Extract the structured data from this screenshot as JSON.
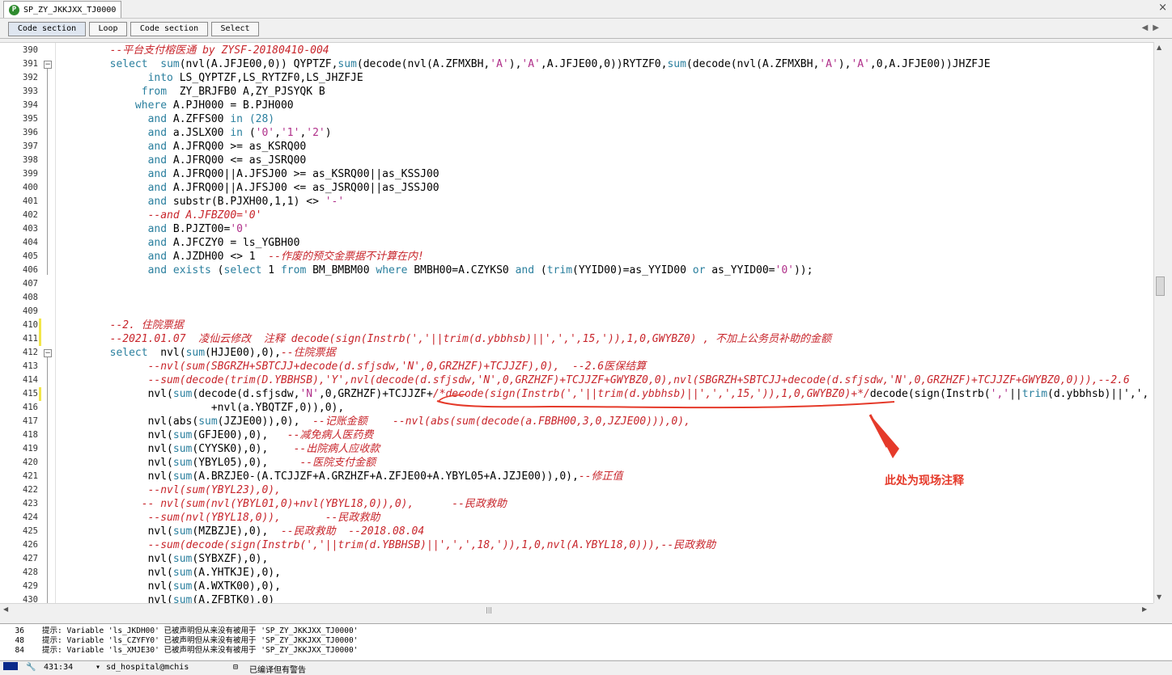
{
  "tab": {
    "title": "SP_ZY_JKKJXX_TJ0000",
    "icon": "procedure-icon",
    "close": "×"
  },
  "toolbar": {
    "buttons": [
      "Code section",
      "Loop",
      "Code section",
      "Select"
    ],
    "nav": "◀▶"
  },
  "editor": {
    "lines": [
      {
        "n": "390",
        "segs": [
          [
            "cm",
            "        --平台支付榕医通 by ZYSF-20180410-004"
          ]
        ]
      },
      {
        "n": "391",
        "segs": [
          [
            "",
            "        "
          ],
          [
            "kw",
            "select"
          ],
          [
            "",
            "  "
          ],
          [
            "kw",
            "sum"
          ],
          [
            "",
            "(nvl(A.JFJE00,0)) QYPTZF,"
          ],
          [
            "kw",
            "sum"
          ],
          [
            "",
            "(decode(nvl(A.ZFMXBH,"
          ],
          [
            "st",
            "'A'"
          ],
          [
            "",
            "),"
          ],
          [
            "st",
            "'A'"
          ],
          [
            "",
            ",A.JFJE00,0))RYTZF0,"
          ],
          [
            "kw",
            "sum"
          ],
          [
            "",
            "(decode(nvl(A.ZFMXBH,"
          ],
          [
            "st",
            "'A'"
          ],
          [
            "",
            "),"
          ],
          [
            "st",
            "'A'"
          ],
          [
            "",
            ",0,A.JFJE00))JHZFJE"
          ]
        ]
      },
      {
        "n": "392",
        "segs": [
          [
            "",
            "              "
          ],
          [
            "kw",
            "into"
          ],
          [
            "",
            " LS_QYPTZF,LS_RYTZF0,LS_JHZFJE"
          ]
        ]
      },
      {
        "n": "393",
        "segs": [
          [
            "",
            "             "
          ],
          [
            "kw",
            "from"
          ],
          [
            "",
            "  ZY_BRJFB0 A,ZY_PJSYQK B"
          ]
        ]
      },
      {
        "n": "394",
        "segs": [
          [
            "",
            "            "
          ],
          [
            "kw",
            "where"
          ],
          [
            "",
            " A.PJH000 = B.PJH000"
          ]
        ]
      },
      {
        "n": "395",
        "segs": [
          [
            "",
            "              "
          ],
          [
            "kw",
            "and"
          ],
          [
            "",
            " A.ZFFS00 "
          ],
          [
            "kw",
            "in"
          ],
          [
            "",
            " "
          ],
          [
            "kw",
            "(28)"
          ]
        ]
      },
      {
        "n": "396",
        "segs": [
          [
            "",
            "              "
          ],
          [
            "kw",
            "and"
          ],
          [
            "",
            " a.JSLX00 "
          ],
          [
            "kw",
            "in"
          ],
          [
            "",
            " ("
          ],
          [
            "st",
            "'0'"
          ],
          [
            "",
            ","
          ],
          [
            "st",
            "'1'"
          ],
          [
            "",
            ","
          ],
          [
            "st",
            "'2'"
          ],
          [
            "",
            ")"
          ]
        ]
      },
      {
        "n": "397",
        "segs": [
          [
            "",
            "              "
          ],
          [
            "kw",
            "and"
          ],
          [
            "",
            " A.JFRQ00 >= as_KSRQ00"
          ]
        ]
      },
      {
        "n": "398",
        "segs": [
          [
            "",
            "              "
          ],
          [
            "kw",
            "and"
          ],
          [
            "",
            " A.JFRQ00 <= as_JSRQ00"
          ]
        ]
      },
      {
        "n": "399",
        "segs": [
          [
            "",
            "              "
          ],
          [
            "kw",
            "and"
          ],
          [
            "",
            " A.JFRQ00||A.JFSJ00 >= as_KSRQ00||as_KSSJ00"
          ]
        ]
      },
      {
        "n": "400",
        "segs": [
          [
            "",
            "              "
          ],
          [
            "kw",
            "and"
          ],
          [
            "",
            " A.JFRQ00||A.JFSJ00 <= as_JSRQ00||as_JSSJ00"
          ]
        ]
      },
      {
        "n": "401",
        "segs": [
          [
            "",
            "              "
          ],
          [
            "kw",
            "and"
          ],
          [
            "",
            " substr(B.PJXH00,1,1) <> "
          ],
          [
            "st",
            "'-'"
          ]
        ]
      },
      {
        "n": "402",
        "segs": [
          [
            "cm",
            "              --and A.JFBZ00='0'"
          ]
        ]
      },
      {
        "n": "403",
        "segs": [
          [
            "",
            "              "
          ],
          [
            "kw",
            "and"
          ],
          [
            "",
            " B.PJZT00="
          ],
          [
            "st",
            "'0'"
          ]
        ]
      },
      {
        "n": "404",
        "segs": [
          [
            "",
            "              "
          ],
          [
            "kw",
            "and"
          ],
          [
            "",
            " A.JFCZY0 = ls_YGBH00"
          ]
        ]
      },
      {
        "n": "405",
        "segs": [
          [
            "",
            "              "
          ],
          [
            "kw",
            "and"
          ],
          [
            "",
            " A.JZDH00 <> 1  "
          ],
          [
            "cm",
            "--作废的预交金票据不计算在内!"
          ]
        ]
      },
      {
        "n": "406",
        "segs": [
          [
            "",
            "              "
          ],
          [
            "kw",
            "and exists"
          ],
          [
            "",
            " ("
          ],
          [
            "kw",
            "select"
          ],
          [
            "",
            " 1 "
          ],
          [
            "kw",
            "from"
          ],
          [
            "",
            " BM_BMBM00 "
          ],
          [
            "kw",
            "where"
          ],
          [
            "",
            " BMBH00=A.CZYKS0 "
          ],
          [
            "kw",
            "and"
          ],
          [
            "",
            " ("
          ],
          [
            "kw",
            "trim"
          ],
          [
            "",
            "(YYID00)=as_YYID00 "
          ],
          [
            "kw",
            "or"
          ],
          [
            "",
            " as_YYID00="
          ],
          [
            "st",
            "'0'"
          ],
          [
            "",
            "));"
          ]
        ]
      },
      {
        "n": "407",
        "segs": [
          [
            "",
            ""
          ]
        ]
      },
      {
        "n": "408",
        "segs": [
          [
            "",
            ""
          ]
        ]
      },
      {
        "n": "409",
        "segs": [
          [
            "",
            ""
          ]
        ]
      },
      {
        "n": "410",
        "segs": [
          [
            "cm",
            "        --2. 住院票据"
          ]
        ]
      },
      {
        "n": "411",
        "segs": [
          [
            "cm",
            "        --2021.01.07  凌仙云修改  注释 decode(sign(Instrb(','||trim(d.ybbhsb)||',',',15,')),1,0,GWYBZ0) , 不加上公务员补助的金额"
          ]
        ]
      },
      {
        "n": "412",
        "segs": [
          [
            "",
            "        "
          ],
          [
            "kw",
            "select"
          ],
          [
            "",
            "  nvl("
          ],
          [
            "kw",
            "sum"
          ],
          [
            "",
            "(HJJE00),0),"
          ],
          [
            "cm",
            "--住院票据"
          ]
        ]
      },
      {
        "n": "413",
        "segs": [
          [
            "cm",
            "              --nvl(sum(SBGRZH+SBTCJJ+decode(d.sfjsdw,'N',0,GRZHZF)+TCJJZF),0),  --2.6医保结算"
          ]
        ]
      },
      {
        "n": "414",
        "segs": [
          [
            "cm",
            "              --sum(decode(trim(D.YBBHSB),'Y',nvl(decode(d.sfjsdw,'N',0,GRZHZF)+TCJJZF+GWYBZ0,0),nvl(SBGRZH+SBTCJJ+decode(d.sfjsdw,'N',0,GRZHZF)+TCJJZF+GWYBZ0,0))),--2.6"
          ]
        ]
      },
      {
        "n": "415",
        "segs": [
          [
            "",
            "              nvl("
          ],
          [
            "kw",
            "sum"
          ],
          [
            "",
            "(decode(d.sfjsdw,"
          ],
          [
            "st",
            "'N'"
          ],
          [
            "",
            ",0,GRZHZF)+TCJJZF+"
          ],
          [
            "cm",
            "/*decode(sign(Instrb(','||trim(d.ybbhsb)||',',',15,')),1,0,GWYBZ0)+*/"
          ],
          [
            "",
            "decode(sign(Instrb("
          ],
          [
            "st",
            "','"
          ],
          [
            "",
            "||"
          ],
          [
            "kw",
            "trim"
          ],
          [
            "",
            "(d.ybbhsb)||',',"
          ]
        ]
      },
      {
        "n": "416",
        "segs": [
          [
            "",
            "                        +nvl(a.YBQTZF,0)),0),"
          ]
        ]
      },
      {
        "n": "417",
        "segs": [
          [
            "",
            "              nvl(abs("
          ],
          [
            "kw",
            "sum"
          ],
          [
            "",
            "(JZJE00)),0),  "
          ],
          [
            "cm",
            "--记账金额    --nvl(abs(sum(decode(a.FBBH00,3,0,JZJE00))),0),"
          ]
        ]
      },
      {
        "n": "418",
        "segs": [
          [
            "",
            "              nvl("
          ],
          [
            "kw",
            "sum"
          ],
          [
            "",
            "(GFJE00),0),   "
          ],
          [
            "cm",
            "--减免病人医药费"
          ]
        ]
      },
      {
        "n": "419",
        "segs": [
          [
            "",
            "              nvl("
          ],
          [
            "kw",
            "sum"
          ],
          [
            "",
            "(CYYSK0),0),    "
          ],
          [
            "cm",
            "--出院病人应收款"
          ]
        ]
      },
      {
        "n": "420",
        "segs": [
          [
            "",
            "              nvl("
          ],
          [
            "kw",
            "sum"
          ],
          [
            "",
            "(YBYL05),0),     "
          ],
          [
            "cm",
            "--医院支付金额"
          ]
        ]
      },
      {
        "n": "421",
        "segs": [
          [
            "",
            "              nvl("
          ],
          [
            "kw",
            "sum"
          ],
          [
            "",
            "(A.BRZJE0-(A.TCJJZF+A.GRZHZF+A.ZFJE00+A.YBYL05+A.JZJE00)),0),"
          ],
          [
            "cm",
            "--修正值"
          ]
        ]
      },
      {
        "n": "422",
        "segs": [
          [
            "cm",
            "              --nvl(sum(YBYL23),0),"
          ]
        ]
      },
      {
        "n": "423",
        "segs": [
          [
            "cm",
            "             -- nvl(sum(nvl(YBYL01,0)+nvl(YBYL18,0)),0),      --民政救助"
          ]
        ]
      },
      {
        "n": "424",
        "segs": [
          [
            "cm",
            "              --sum(nvl(YBYL18,0)),       --民政救助"
          ]
        ]
      },
      {
        "n": "425",
        "segs": [
          [
            "",
            "              nvl("
          ],
          [
            "kw",
            "sum"
          ],
          [
            "",
            "(MZBZJE),0),  "
          ],
          [
            "cm",
            "--民政救助  --2018.08.04"
          ]
        ]
      },
      {
        "n": "426",
        "segs": [
          [
            "cm",
            "              --sum(decode(sign(Instrb(','||trim(d.YBBHSB)||',',',18,')),1,0,nvl(A.YBYL18,0))),--民政救助"
          ]
        ]
      },
      {
        "n": "427",
        "segs": [
          [
            "",
            "              nvl("
          ],
          [
            "kw",
            "sum"
          ],
          [
            "",
            "(SYBXZF),0),"
          ]
        ]
      },
      {
        "n": "428",
        "segs": [
          [
            "",
            "              nvl("
          ],
          [
            "kw",
            "sum"
          ],
          [
            "",
            "(A.YHTKJE),0),"
          ]
        ]
      },
      {
        "n": "429",
        "segs": [
          [
            "",
            "              nvl("
          ],
          [
            "kw",
            "sum"
          ],
          [
            "",
            "(A.WXTK00),0),"
          ]
        ]
      },
      {
        "n": "430",
        "segs": [
          [
            "",
            "              nvl("
          ],
          [
            "kw",
            "sum"
          ],
          [
            "",
            "(A.ZFBTK0),0)"
          ]
        ]
      }
    ]
  },
  "annotation": {
    "text": "此处为现场注释",
    "color": "#e53a2a"
  },
  "messages": [
    {
      "n": "36",
      "text": "提示: Variable 'ls_JKDH00' 已被声明但从来没有被用于 'SP_ZY_JKKJXX_TJ0000'"
    },
    {
      "n": "48",
      "text": "提示: Variable 'ls_CZYFY0' 已被声明但从来没有被用于 'SP_ZY_JKKJXX_TJ0000'"
    },
    {
      "n": "84",
      "text": "提示: Variable 'ls_XMJE30' 已被声明但从来没有被用于 'SP_ZY_JKKJXX_TJ0000'"
    }
  ],
  "status": {
    "position": "431:34",
    "connection": "sd_hospital@mchis",
    "compile": "已编译但有警告"
  }
}
